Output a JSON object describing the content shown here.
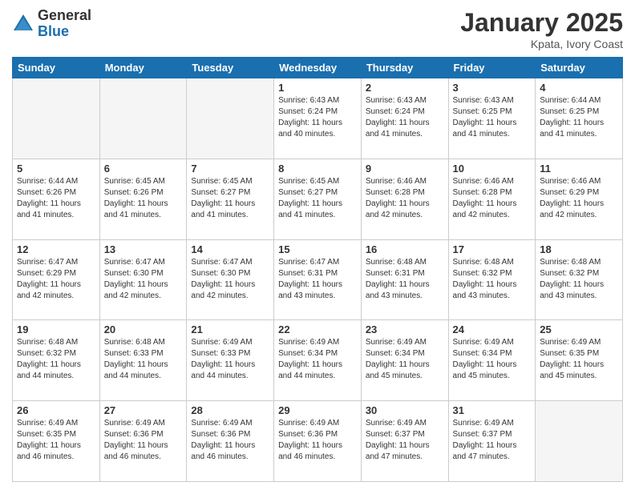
{
  "header": {
    "logo_general": "General",
    "logo_blue": "Blue",
    "title": "January 2025",
    "location": "Kpata, Ivory Coast"
  },
  "weekdays": [
    "Sunday",
    "Monday",
    "Tuesday",
    "Wednesday",
    "Thursday",
    "Friday",
    "Saturday"
  ],
  "weeks": [
    [
      {
        "day": "",
        "sunrise": "",
        "sunset": "",
        "daylight": ""
      },
      {
        "day": "",
        "sunrise": "",
        "sunset": "",
        "daylight": ""
      },
      {
        "day": "",
        "sunrise": "",
        "sunset": "",
        "daylight": ""
      },
      {
        "day": "1",
        "sunrise": "Sunrise: 6:43 AM",
        "sunset": "Sunset: 6:24 PM",
        "daylight": "Daylight: 11 hours and 40 minutes."
      },
      {
        "day": "2",
        "sunrise": "Sunrise: 6:43 AM",
        "sunset": "Sunset: 6:24 PM",
        "daylight": "Daylight: 11 hours and 41 minutes."
      },
      {
        "day": "3",
        "sunrise": "Sunrise: 6:43 AM",
        "sunset": "Sunset: 6:25 PM",
        "daylight": "Daylight: 11 hours and 41 minutes."
      },
      {
        "day": "4",
        "sunrise": "Sunrise: 6:44 AM",
        "sunset": "Sunset: 6:25 PM",
        "daylight": "Daylight: 11 hours and 41 minutes."
      }
    ],
    [
      {
        "day": "5",
        "sunrise": "Sunrise: 6:44 AM",
        "sunset": "Sunset: 6:26 PM",
        "daylight": "Daylight: 11 hours and 41 minutes."
      },
      {
        "day": "6",
        "sunrise": "Sunrise: 6:45 AM",
        "sunset": "Sunset: 6:26 PM",
        "daylight": "Daylight: 11 hours and 41 minutes."
      },
      {
        "day": "7",
        "sunrise": "Sunrise: 6:45 AM",
        "sunset": "Sunset: 6:27 PM",
        "daylight": "Daylight: 11 hours and 41 minutes."
      },
      {
        "day": "8",
        "sunrise": "Sunrise: 6:45 AM",
        "sunset": "Sunset: 6:27 PM",
        "daylight": "Daylight: 11 hours and 41 minutes."
      },
      {
        "day": "9",
        "sunrise": "Sunrise: 6:46 AM",
        "sunset": "Sunset: 6:28 PM",
        "daylight": "Daylight: 11 hours and 42 minutes."
      },
      {
        "day": "10",
        "sunrise": "Sunrise: 6:46 AM",
        "sunset": "Sunset: 6:28 PM",
        "daylight": "Daylight: 11 hours and 42 minutes."
      },
      {
        "day": "11",
        "sunrise": "Sunrise: 6:46 AM",
        "sunset": "Sunset: 6:29 PM",
        "daylight": "Daylight: 11 hours and 42 minutes."
      }
    ],
    [
      {
        "day": "12",
        "sunrise": "Sunrise: 6:47 AM",
        "sunset": "Sunset: 6:29 PM",
        "daylight": "Daylight: 11 hours and 42 minutes."
      },
      {
        "day": "13",
        "sunrise": "Sunrise: 6:47 AM",
        "sunset": "Sunset: 6:30 PM",
        "daylight": "Daylight: 11 hours and 42 minutes."
      },
      {
        "day": "14",
        "sunrise": "Sunrise: 6:47 AM",
        "sunset": "Sunset: 6:30 PM",
        "daylight": "Daylight: 11 hours and 42 minutes."
      },
      {
        "day": "15",
        "sunrise": "Sunrise: 6:47 AM",
        "sunset": "Sunset: 6:31 PM",
        "daylight": "Daylight: 11 hours and 43 minutes."
      },
      {
        "day": "16",
        "sunrise": "Sunrise: 6:48 AM",
        "sunset": "Sunset: 6:31 PM",
        "daylight": "Daylight: 11 hours and 43 minutes."
      },
      {
        "day": "17",
        "sunrise": "Sunrise: 6:48 AM",
        "sunset": "Sunset: 6:32 PM",
        "daylight": "Daylight: 11 hours and 43 minutes."
      },
      {
        "day": "18",
        "sunrise": "Sunrise: 6:48 AM",
        "sunset": "Sunset: 6:32 PM",
        "daylight": "Daylight: 11 hours and 43 minutes."
      }
    ],
    [
      {
        "day": "19",
        "sunrise": "Sunrise: 6:48 AM",
        "sunset": "Sunset: 6:32 PM",
        "daylight": "Daylight: 11 hours and 44 minutes."
      },
      {
        "day": "20",
        "sunrise": "Sunrise: 6:48 AM",
        "sunset": "Sunset: 6:33 PM",
        "daylight": "Daylight: 11 hours and 44 minutes."
      },
      {
        "day": "21",
        "sunrise": "Sunrise: 6:49 AM",
        "sunset": "Sunset: 6:33 PM",
        "daylight": "Daylight: 11 hours and 44 minutes."
      },
      {
        "day": "22",
        "sunrise": "Sunrise: 6:49 AM",
        "sunset": "Sunset: 6:34 PM",
        "daylight": "Daylight: 11 hours and 44 minutes."
      },
      {
        "day": "23",
        "sunrise": "Sunrise: 6:49 AM",
        "sunset": "Sunset: 6:34 PM",
        "daylight": "Daylight: 11 hours and 45 minutes."
      },
      {
        "day": "24",
        "sunrise": "Sunrise: 6:49 AM",
        "sunset": "Sunset: 6:34 PM",
        "daylight": "Daylight: 11 hours and 45 minutes."
      },
      {
        "day": "25",
        "sunrise": "Sunrise: 6:49 AM",
        "sunset": "Sunset: 6:35 PM",
        "daylight": "Daylight: 11 hours and 45 minutes."
      }
    ],
    [
      {
        "day": "26",
        "sunrise": "Sunrise: 6:49 AM",
        "sunset": "Sunset: 6:35 PM",
        "daylight": "Daylight: 11 hours and 46 minutes."
      },
      {
        "day": "27",
        "sunrise": "Sunrise: 6:49 AM",
        "sunset": "Sunset: 6:36 PM",
        "daylight": "Daylight: 11 hours and 46 minutes."
      },
      {
        "day": "28",
        "sunrise": "Sunrise: 6:49 AM",
        "sunset": "Sunset: 6:36 PM",
        "daylight": "Daylight: 11 hours and 46 minutes."
      },
      {
        "day": "29",
        "sunrise": "Sunrise: 6:49 AM",
        "sunset": "Sunset: 6:36 PM",
        "daylight": "Daylight: 11 hours and 46 minutes."
      },
      {
        "day": "30",
        "sunrise": "Sunrise: 6:49 AM",
        "sunset": "Sunset: 6:37 PM",
        "daylight": "Daylight: 11 hours and 47 minutes."
      },
      {
        "day": "31",
        "sunrise": "Sunrise: 6:49 AM",
        "sunset": "Sunset: 6:37 PM",
        "daylight": "Daylight: 11 hours and 47 minutes."
      },
      {
        "day": "",
        "sunrise": "",
        "sunset": "",
        "daylight": ""
      }
    ]
  ]
}
